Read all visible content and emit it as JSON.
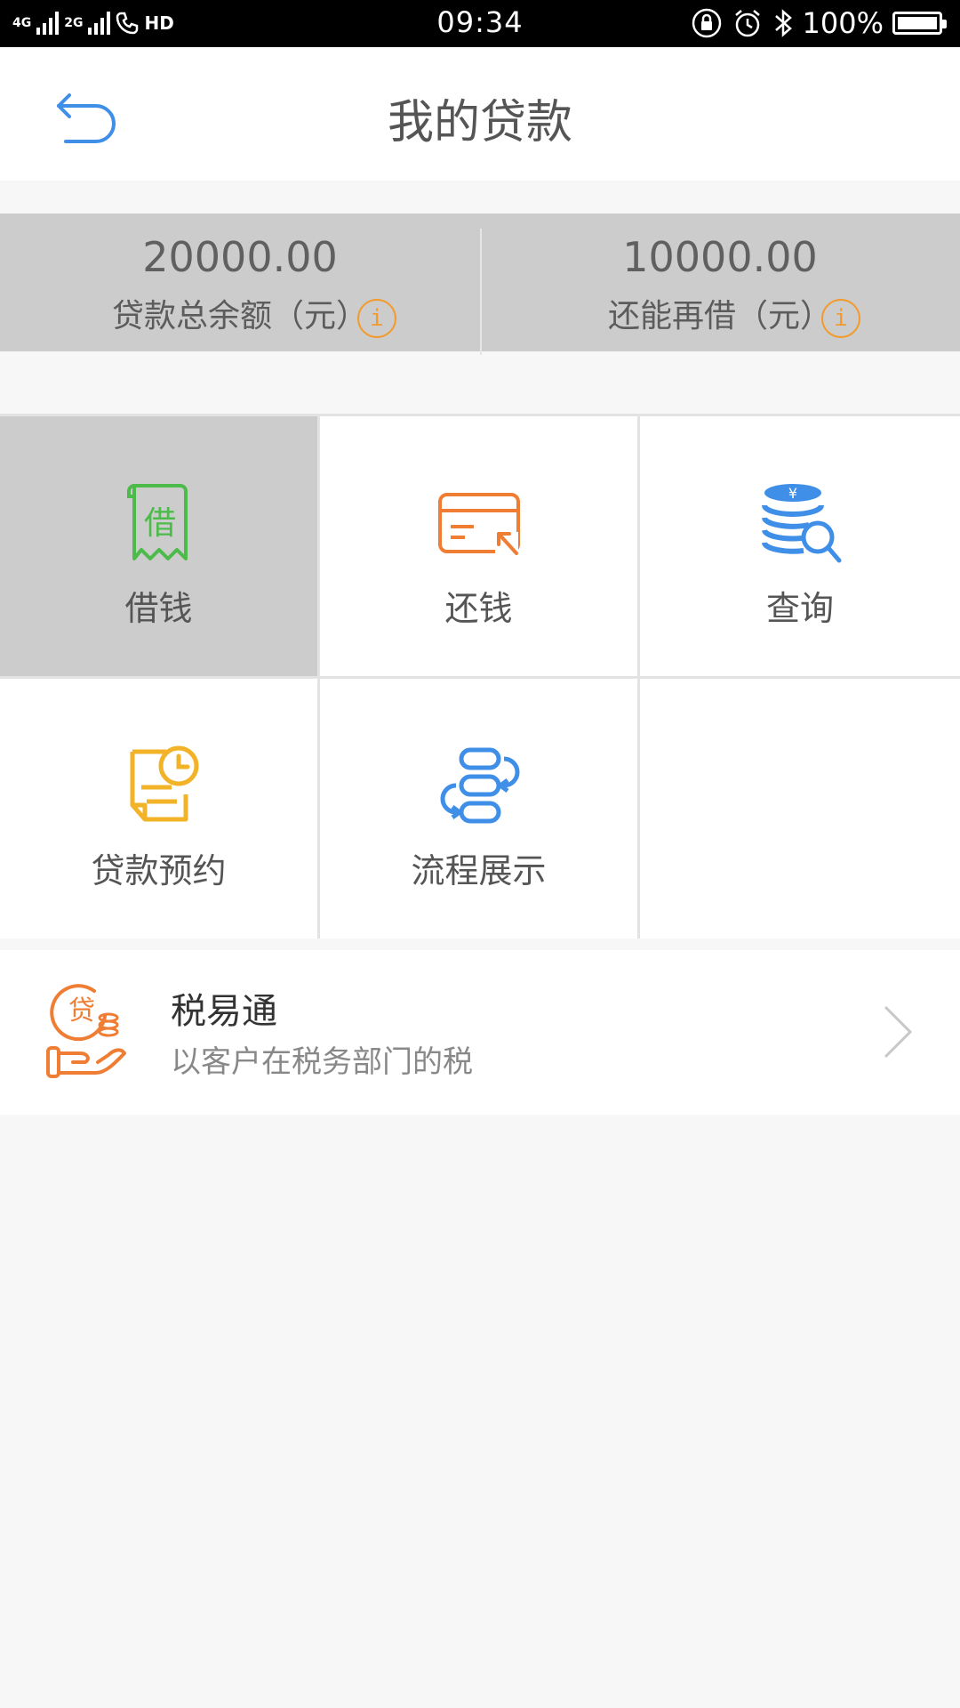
{
  "status_bar": {
    "net1": "4G",
    "net2": "2G",
    "hd": "HD",
    "time": "09:34",
    "battery": "100%"
  },
  "header": {
    "title": "我的贷款"
  },
  "summary": [
    {
      "amount": "20000.00",
      "label": "贷款总余额（元）"
    },
    {
      "amount": "10000.00",
      "label": "还能再借（元）"
    }
  ],
  "info_glyph": "i",
  "menu": [
    {
      "label": "借钱",
      "icon_text": "借",
      "icon": "borrow-receipt-icon",
      "color": "#4cbb4a"
    },
    {
      "label": "还钱",
      "icon": "repay-card-icon",
      "color": "#f07d34"
    },
    {
      "label": "查询",
      "icon_text": "¥",
      "icon": "coin-search-icon",
      "color": "#3f8fe8"
    },
    {
      "label": "贷款预约",
      "icon": "appointment-document-icon",
      "color": "#f2b329"
    },
    {
      "label": "流程展示",
      "icon": "process-flow-icon",
      "color": "#3f8fe8"
    }
  ],
  "product": {
    "title": "税易通",
    "subtitle": "以客户在税务部门的税",
    "icon_text": "贷",
    "icon": "loan-hand-icon",
    "color": "#f07d34"
  },
  "colors": {
    "back": "#3f8fe8",
    "info": "#f39a2b"
  }
}
